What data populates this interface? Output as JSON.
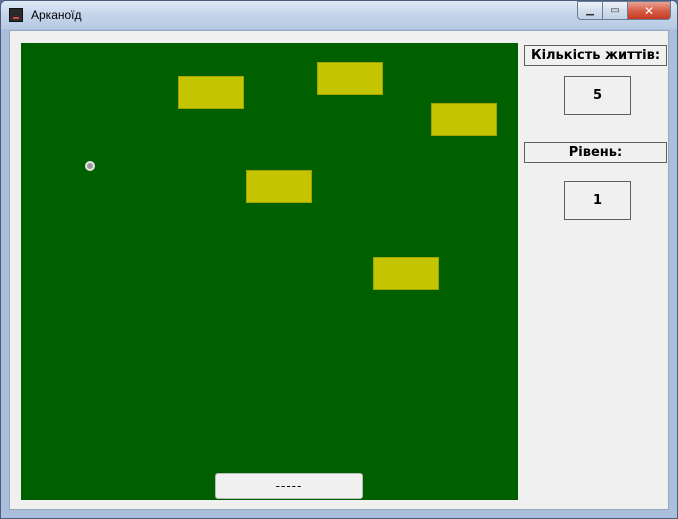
{
  "window": {
    "title": "Арканоїд",
    "min_glyph": "▁",
    "max_glyph": "▭",
    "close_glyph": "✕"
  },
  "game": {
    "paddle_label": "-----"
  },
  "sidebar": {
    "lives_label": "Кількість життів:",
    "lives_value": "5",
    "level_label": "Рівень:",
    "level_value": "1"
  },
  "colors": {
    "field": "#006000",
    "brick": "#c4c400",
    "ball": "#9a9a9a"
  }
}
